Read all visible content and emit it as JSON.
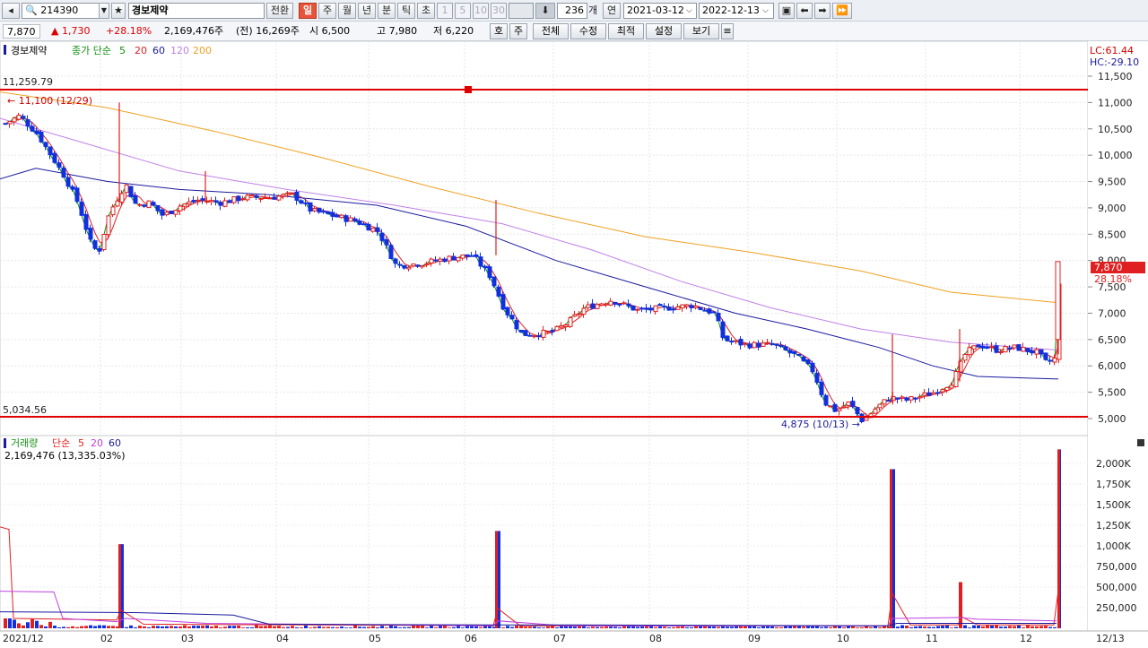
{
  "toolbar": {
    "code": "214390",
    "name": "경보제약",
    "convert_label": "전환",
    "period_buttons": [
      "일",
      "주",
      "월",
      "년",
      "분",
      "틱",
      "초"
    ],
    "minute_buttons": [
      "1",
      "5",
      "10",
      "30"
    ],
    "count_value": "236",
    "count_unit": "개",
    "year_label": "연",
    "start_date": "2021-03-12",
    "end_date": "2022-12-13"
  },
  "quote": {
    "price": "7,870",
    "change": "▲ 1,730",
    "change_pct": "+28.18%",
    "volume": "2,169,476주",
    "prev_volume": "(전) 16,269주",
    "open": "시 6,500",
    "high": "고 7,980",
    "low": "저 6,220",
    "buttons": [
      "호",
      "주",
      "전체",
      "수정",
      "최적",
      "설정",
      "보기"
    ]
  },
  "price_panel": {
    "legend_name": "경보제약",
    "legend_ma_label": "종가 단순",
    "legend_ma_periods": [
      "5",
      "20",
      "60",
      "120",
      "200"
    ],
    "legend_ma_colors": [
      "#109010",
      "#e02020",
      "#1a1aa0",
      "#c080e8",
      "#f0a020"
    ],
    "lc": "LC:61.44",
    "hc": "HC:-29.10",
    "y_ticks": [
      "11,500",
      "11,000",
      "10,500",
      "10,000",
      "9,500",
      "9,000",
      "8,500",
      "8,000",
      "7,500",
      "7,000",
      "6,500",
      "6,000",
      "5,500",
      "5,000"
    ],
    "hline_high_label": "11,259.79",
    "hline_low_label": "5,034.56",
    "max_marker": "11,100 (12/29)",
    "min_marker": "4,875 (10/13)",
    "last_price_tag": "7,870",
    "last_pct_tag": "28.18%"
  },
  "volume_panel": {
    "legend_name": "거래량",
    "legend_ma_label": "단순",
    "legend_ma_periods": [
      "5",
      "20",
      "60"
    ],
    "legend_ma_colors": [
      "#e02020",
      "#c040e0",
      "#1a1aa0"
    ],
    "current_value": "2,169,476 (13,335.03%)",
    "y_ticks": [
      "2,000K",
      "1,750K",
      "1,500K",
      "1,250K",
      "1,000K",
      "750,000",
      "500,000",
      "250,000"
    ]
  },
  "x_axis": {
    "labels": [
      "2021/12",
      "02",
      "03",
      "04",
      "05",
      "06",
      "07",
      "08",
      "09",
      "10",
      "11",
      "12",
      "12/13"
    ]
  },
  "colors": {
    "up": "#e02020",
    "down": "#1030e0",
    "hline": "#e00000"
  }
}
